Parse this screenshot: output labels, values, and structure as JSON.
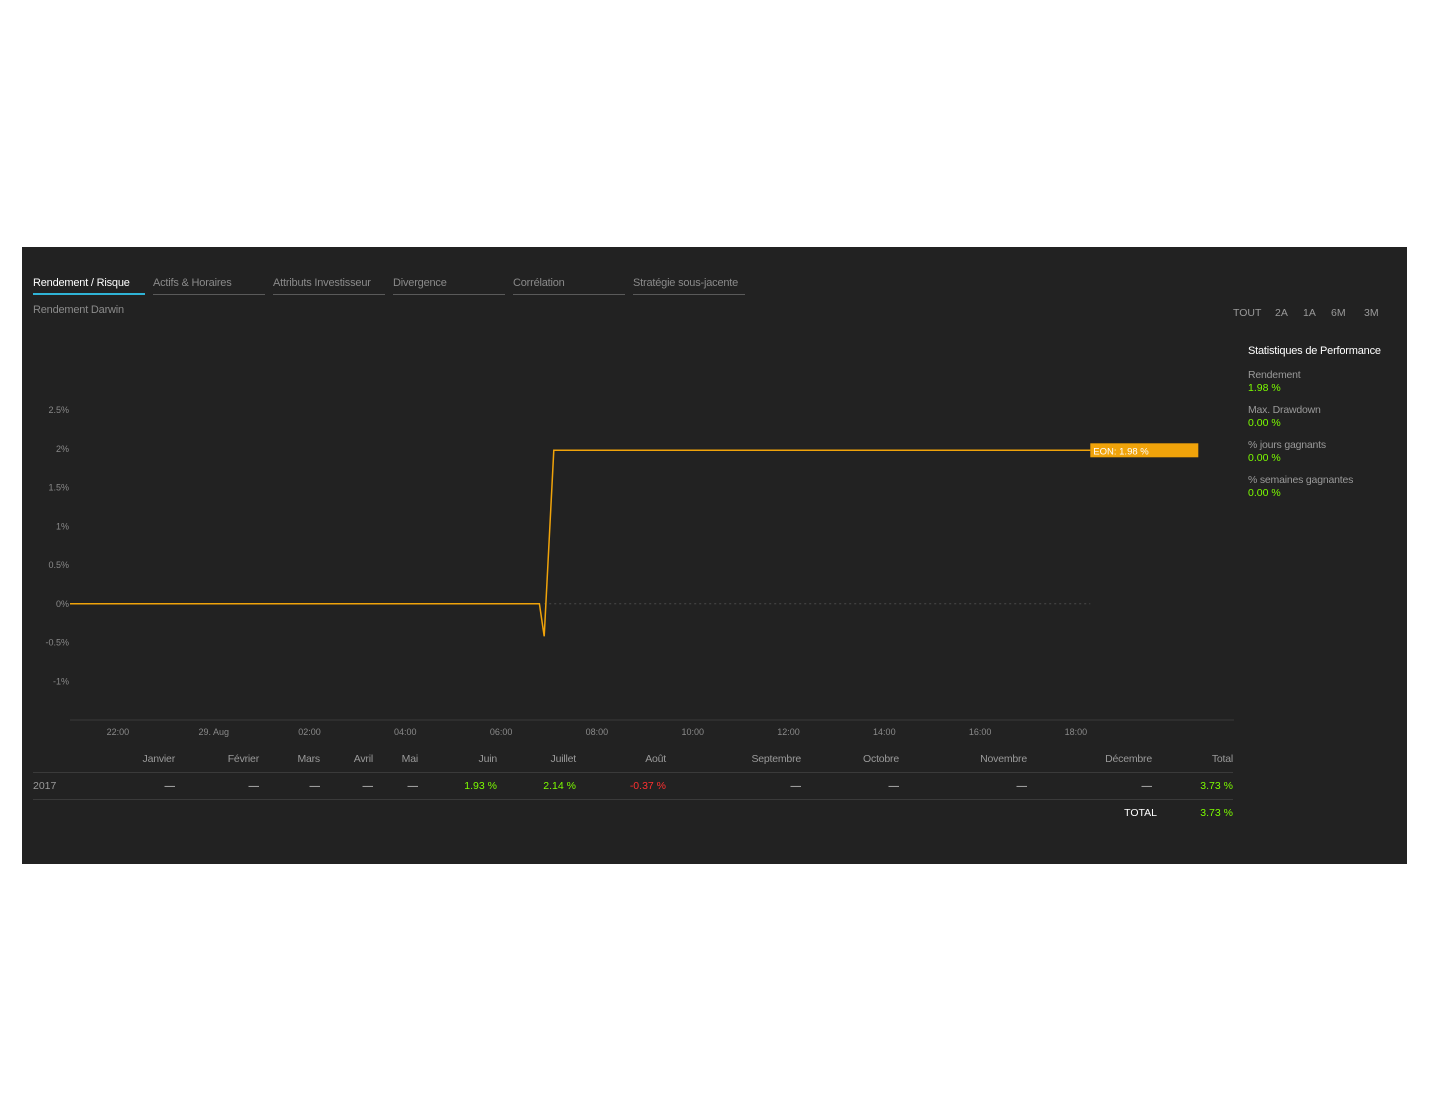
{
  "tabs": [
    {
      "label": "Rendement / Risque",
      "active": true
    },
    {
      "label": "Actifs & Horaires",
      "active": false
    },
    {
      "label": "Attributs Investisseur",
      "active": false
    },
    {
      "label": "Divergence",
      "active": false
    },
    {
      "label": "Corrélation",
      "active": false
    },
    {
      "label": "Stratégie sous-jacente",
      "active": false
    }
  ],
  "chart_subtitle": "Rendement Darwin",
  "ranges": [
    "TOUT",
    "2A",
    "1A",
    "6M",
    "3M"
  ],
  "stats": {
    "title": "Statistiques de Performance",
    "items": [
      {
        "label": "Rendement",
        "value": "1.98 %"
      },
      {
        "label": "Max. Drawdown",
        "value": "0.00 %"
      },
      {
        "label": "% jours gagnants",
        "value": "0.00 %"
      },
      {
        "label": "% semaines gagnantes",
        "value": "0.00 %"
      }
    ]
  },
  "colors": {
    "background": "#222222",
    "line": "#f0a30a",
    "positive": "#7cfc00",
    "negative": "#ff3030",
    "tab_active": "#2fb3d6"
  },
  "chart_data": {
    "type": "line",
    "title": "",
    "xlabel": "",
    "ylabel": "",
    "y_tick_labels": [
      "2.5%",
      "2%",
      "1.5%",
      "1%",
      "0.5%",
      "0%",
      "-0.5%",
      "-1%"
    ],
    "y_ticks": [
      2.5,
      2,
      1.5,
      1,
      0.5,
      0,
      -0.5,
      -1
    ],
    "ylim": [
      -1.5,
      2.5
    ],
    "x_tick_labels": [
      "22:00",
      "29. Aug",
      "02:00",
      "04:00",
      "06:00",
      "08:00",
      "10:00",
      "12:00",
      "14:00",
      "16:00",
      "18:00"
    ],
    "x_ticks": [
      22,
      24,
      26,
      28,
      30,
      32,
      34,
      36,
      38,
      40,
      42
    ],
    "xlim": [
      21,
      45.3
    ],
    "grid": false,
    "series": [
      {
        "name": "EON",
        "x": [
          21,
          30.8,
          30.9,
          31.1,
          42.3
        ],
        "values": [
          0,
          0,
          -0.42,
          1.98,
          1.98
        ]
      }
    ],
    "annotation": "EON: 1.98 %",
    "annotation_value": 1.98
  },
  "monthly": {
    "months": [
      "Janvier",
      "Février",
      "Mars",
      "Avril",
      "Mai",
      "Juin",
      "Juillet",
      "Août",
      "Septembre",
      "Octobre",
      "Novembre",
      "Décembre",
      "Total"
    ],
    "rows": [
      {
        "year": "2017",
        "values": [
          "—",
          "—",
          "—",
          "—",
          "—",
          "1.93 %",
          "2.14 %",
          "-0.37 %",
          "—",
          "—",
          "—",
          "—",
          "3.73 %"
        ],
        "kinds": [
          "dash",
          "dash",
          "dash",
          "dash",
          "dash",
          "pos",
          "pos",
          "neg",
          "dash",
          "dash",
          "dash",
          "dash",
          "pos"
        ]
      }
    ],
    "total_label": "TOTAL",
    "total_value": "3.73 %"
  }
}
